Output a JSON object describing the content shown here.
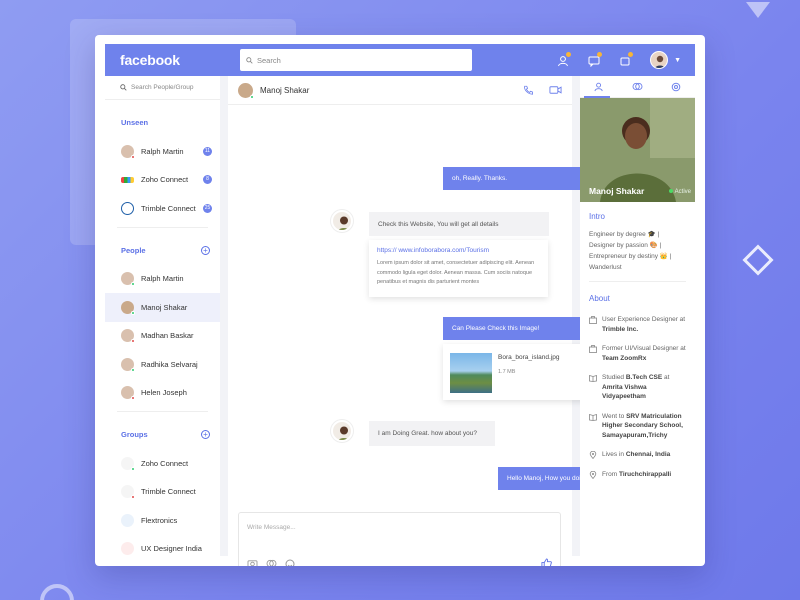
{
  "app": {
    "logo": "facebook",
    "brand_color": "#6f82ec"
  },
  "topbar": {
    "search_placeholder": "Search"
  },
  "sidebar": {
    "search_label": "Search People/Group",
    "unseen_title": "Unseen",
    "unseen": [
      {
        "name": "Ralph Martin",
        "count": "11"
      },
      {
        "name": "Zoho Connect",
        "count": "8"
      },
      {
        "name": "Trimble Connect",
        "count": "25"
      }
    ],
    "people_title": "People",
    "people": [
      {
        "name": "Ralph Martin"
      },
      {
        "name": "Manoj Shakar"
      },
      {
        "name": "Madhan Baskar"
      },
      {
        "name": "Radhika Selvaraj"
      },
      {
        "name": "Helen Joseph"
      }
    ],
    "groups_title": "Groups",
    "groups": [
      {
        "name": "Zoho Connect"
      },
      {
        "name": "Trimble Connect"
      },
      {
        "name": "Flextronics"
      },
      {
        "name": "UX Designer India"
      }
    ]
  },
  "chat": {
    "contact_name": "Manoj Shakar",
    "messages": {
      "m1": "oh, Really. Thanks.",
      "m2": "Check this Website, You will get all details",
      "link_url": "https:// www.infoborabora.com/Tourism",
      "link_text": "Lorem ipsum dolor sit amet, consectetuer adipiscing elit. Aenean commodo ligula eget dolor. Aenean massa. Cum sociis natoque penatibus et magnis dis parturient montes",
      "m3": "Can Please Check this Image!",
      "file_name": "Bora_bora_island.jpg",
      "file_size": "1.7 MB",
      "m4": "I am Doing Great. how about you?",
      "m5": "Hello Manoj, How you doing?"
    },
    "composer_placeholder": "Write Message..."
  },
  "profile": {
    "name": "Manoj Shakar",
    "status": "Active",
    "intro_title": "Intro",
    "intro_text": "Engineer by degree 🎓 | Designer by passion 🎨 | Entrepreneur by destiny 👑 | Wanderlust",
    "about_title": "About",
    "about": [
      {
        "text": "User Experience Designer at ",
        "bold": "Trimble Inc."
      },
      {
        "text": "Former UI/Visual Designer at ",
        "bold": "Team ZoomRx"
      },
      {
        "text": "Studied ",
        "bold": "B.Tech CSE",
        "text2": " at ",
        "bold2": "Amrita Vishwa Vidyapeetham"
      },
      {
        "text": "Went to ",
        "bold": "SRV Matriculation Higher Secondary School, Samayapuram,Trichy"
      },
      {
        "text": "Lives in ",
        "bold": "Chennai, India"
      },
      {
        "text": "From ",
        "bold": "Tiruchchirappalli"
      }
    ]
  }
}
